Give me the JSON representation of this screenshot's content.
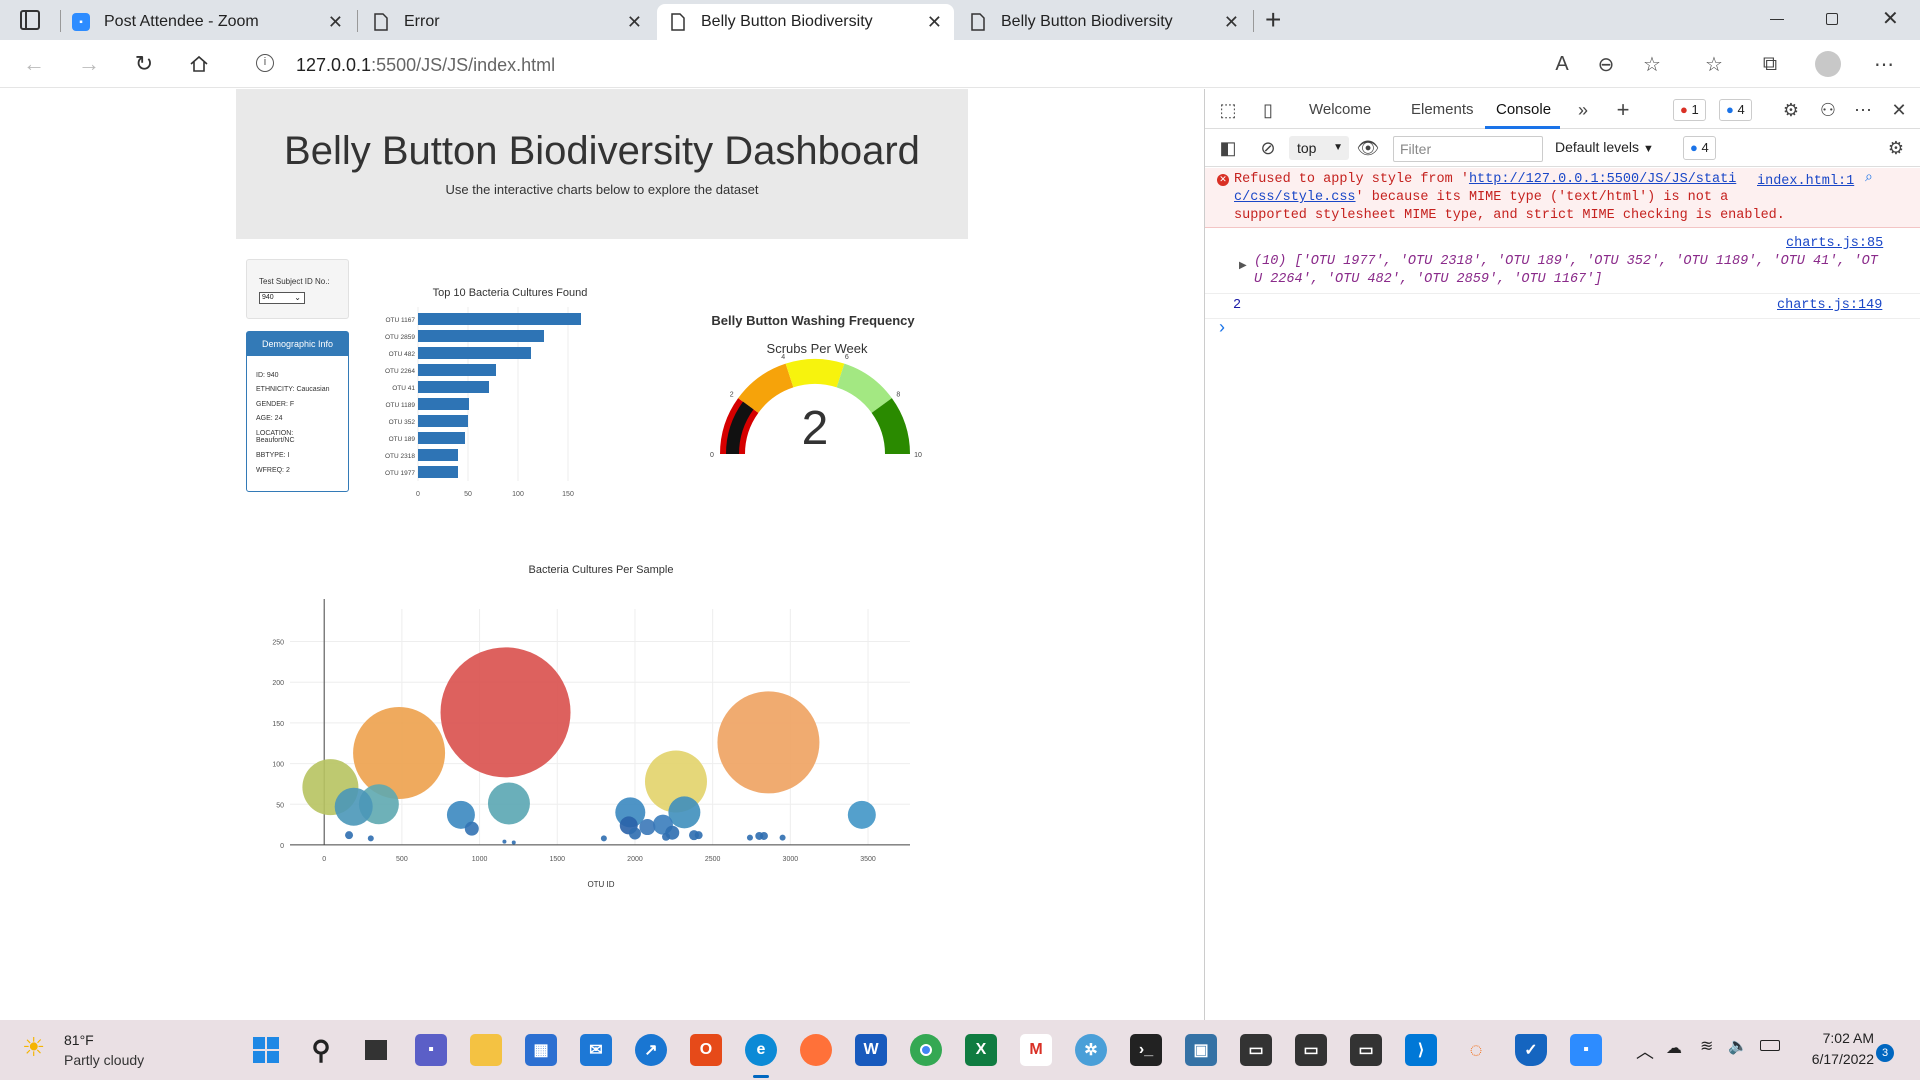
{
  "browser": {
    "tabs": [
      {
        "title": "Post Attendee - Zoom",
        "icon": "zoom-icon"
      },
      {
        "title": "Error",
        "icon": "document-icon"
      },
      {
        "title": "Belly Button Biodiversity",
        "icon": "document-icon",
        "active": true
      },
      {
        "title": "Belly Button Biodiversity",
        "icon": "document-icon"
      }
    ],
    "url_host": "127.0.0.1",
    "url_path": ":5500/JS/JS/index.html"
  },
  "page": {
    "title": "Belly Button Biodiversity Dashboard",
    "subtitle": "Use the interactive charts below to explore the dataset",
    "subject_label": "Test Subject ID No.:",
    "subject_value": "940",
    "demo_title": "Demographic Info",
    "demo": {
      "id": "ID: 940",
      "ethnicity": "ETHNICITY: Caucasian",
      "gender": "GENDER: F",
      "age": "AGE: 24",
      "location_1": "LOCATION:",
      "location_2": "Beaufort/NC",
      "bbtype": "BBTYPE: I",
      "wfreq": "WFREQ: 2"
    }
  },
  "chart_data": [
    {
      "type": "bar",
      "orientation": "horizontal",
      "title": "Top 10 Bacteria Cultures Found",
      "categories": [
        "OTU 1167",
        "OTU 2859",
        "OTU 482",
        "OTU 2264",
        "OTU 41",
        "OTU 1189",
        "OTU 352",
        "OTU 189",
        "OTU 2318",
        "OTU 1977"
      ],
      "values": [
        163,
        126,
        113,
        78,
        71,
        51,
        50,
        47,
        40,
        40
      ],
      "xticks": [
        "0",
        "50",
        "100",
        "150"
      ],
      "xlim": [
        0,
        170
      ],
      "color": "#2e74b5"
    },
    {
      "type": "gauge",
      "title": "Belly Button Washing Frequency",
      "subtitle": "Scrubs Per Week",
      "value": 2,
      "value_label": "2",
      "range": [
        0,
        10
      ],
      "ticks": [
        "0",
        "2",
        "4",
        "6",
        "8",
        "10"
      ],
      "bands": [
        {
          "from": 0,
          "to": 2,
          "color": "#d50000"
        },
        {
          "from": 2,
          "to": 4,
          "color": "#f6a30a"
        },
        {
          "from": 4,
          "to": 6,
          "color": "#f7f30d"
        },
        {
          "from": 6,
          "to": 8,
          "color": "#a3e882"
        },
        {
          "from": 8,
          "to": 10,
          "color": "#2a8a00"
        }
      ],
      "bar_color": "#111111"
    },
    {
      "type": "scatter",
      "title": "Bacteria Cultures Per Sample",
      "xlabel": "OTU ID",
      "xticks": [
        "0",
        "500",
        "1000",
        "1500",
        "2000",
        "2500",
        "3000",
        "3500"
      ],
      "yticks": [
        "0",
        "50",
        "100",
        "150",
        "200",
        "250"
      ],
      "xlim": [
        -220,
        3770
      ],
      "ylim": [
        -5,
        290
      ],
      "points": [
        {
          "x": 40,
          "y": 71,
          "r": 28,
          "c": "#b7c360"
        },
        {
          "x": 190,
          "y": 47,
          "r": 19,
          "c": "#4a97b8"
        },
        {
          "x": 352,
          "y": 50,
          "r": 20,
          "c": "#5ea9b0"
        },
        {
          "x": 482,
          "y": 113,
          "r": 46,
          "c": "#eda14d"
        },
        {
          "x": 160,
          "y": 12,
          "r": 4,
          "c": "#2f6eb0"
        },
        {
          "x": 300,
          "y": 8,
          "r": 3,
          "c": "#2f6eb0"
        },
        {
          "x": 880,
          "y": 37,
          "r": 14,
          "c": "#3b88c0"
        },
        {
          "x": 950,
          "y": 20,
          "r": 7,
          "c": "#3372b3"
        },
        {
          "x": 1167,
          "y": 163,
          "r": 65,
          "c": "#d9504d"
        },
        {
          "x": 1189,
          "y": 51,
          "r": 21,
          "c": "#5aa6b3"
        },
        {
          "x": 1160,
          "y": 4,
          "r": 2,
          "c": "#2f6eb0"
        },
        {
          "x": 1220,
          "y": 3,
          "r": 2,
          "c": "#2f6eb0"
        },
        {
          "x": 1800,
          "y": 8,
          "r": 3,
          "c": "#2f6eb0"
        },
        {
          "x": 1970,
          "y": 40,
          "r": 15,
          "c": "#3b88c0"
        },
        {
          "x": 1960,
          "y": 24,
          "r": 9,
          "c": "#2a62a8"
        },
        {
          "x": 2000,
          "y": 14,
          "r": 6,
          "c": "#2f6eb0"
        },
        {
          "x": 2080,
          "y": 22,
          "r": 8,
          "c": "#3b78b8"
        },
        {
          "x": 2180,
          "y": 25,
          "r": 10,
          "c": "#3a7dbc"
        },
        {
          "x": 2240,
          "y": 15,
          "r": 7,
          "c": "#2f6eb0"
        },
        {
          "x": 2264,
          "y": 78,
          "r": 31,
          "c": "#e2d36a"
        },
        {
          "x": 2318,
          "y": 40,
          "r": 16,
          "c": "#3f8fbc"
        },
        {
          "x": 2200,
          "y": 10,
          "r": 4,
          "c": "#2f6eb0"
        },
        {
          "x": 2380,
          "y": 12,
          "r": 5,
          "c": "#2f6eb0"
        },
        {
          "x": 2410,
          "y": 12,
          "r": 4,
          "c": "#2f6eb0"
        },
        {
          "x": 2859,
          "y": 126,
          "r": 51,
          "c": "#eea260"
        },
        {
          "x": 2740,
          "y": 9,
          "r": 3,
          "c": "#2f6eb0"
        },
        {
          "x": 2800,
          "y": 11,
          "r": 4,
          "c": "#2f6eb0"
        },
        {
          "x": 2830,
          "y": 11,
          "r": 4,
          "c": "#2f6eb0"
        },
        {
          "x": 2950,
          "y": 9,
          "r": 3,
          "c": "#2f6eb0"
        },
        {
          "x": 3460,
          "y": 37,
          "r": 14,
          "c": "#4196c6"
        }
      ]
    }
  ],
  "devtools": {
    "tabs": [
      "Welcome",
      "Elements",
      "Console"
    ],
    "active_tab": "Console",
    "error_count": "1",
    "info_count": "4",
    "context": "top",
    "filter_placeholder": "Filter",
    "levels": "Default levels",
    "issues_count": "4",
    "error": {
      "line1_pre": "Refused to apply style from '",
      "line1_link": "http://127.0.0.1:5500/JS/JS/stati",
      "line2_link": "c/css/style.css",
      "line2_post": "' because its MIME type ('text/html') is not a",
      "line3": "supported stylesheet MIME type, and strict MIME checking is enabled.",
      "source": "index.html:1"
    },
    "log1": {
      "source": "charts.js:85",
      "line1": "(10) ['OTU 1977', 'OTU 2318', 'OTU 189', 'OTU 352', 'OTU 1189', 'OTU 41', 'OT",
      "line2": "U 2264', 'OTU 482', 'OTU 2859', 'OTU 1167']"
    },
    "log2": {
      "value": "2",
      "source": "charts.js:149"
    }
  },
  "taskbar": {
    "weather_temp": "81°F",
    "weather_desc": "Partly cloudy",
    "time": "7:02 AM",
    "date": "6/17/2022",
    "notif_count": "3"
  }
}
